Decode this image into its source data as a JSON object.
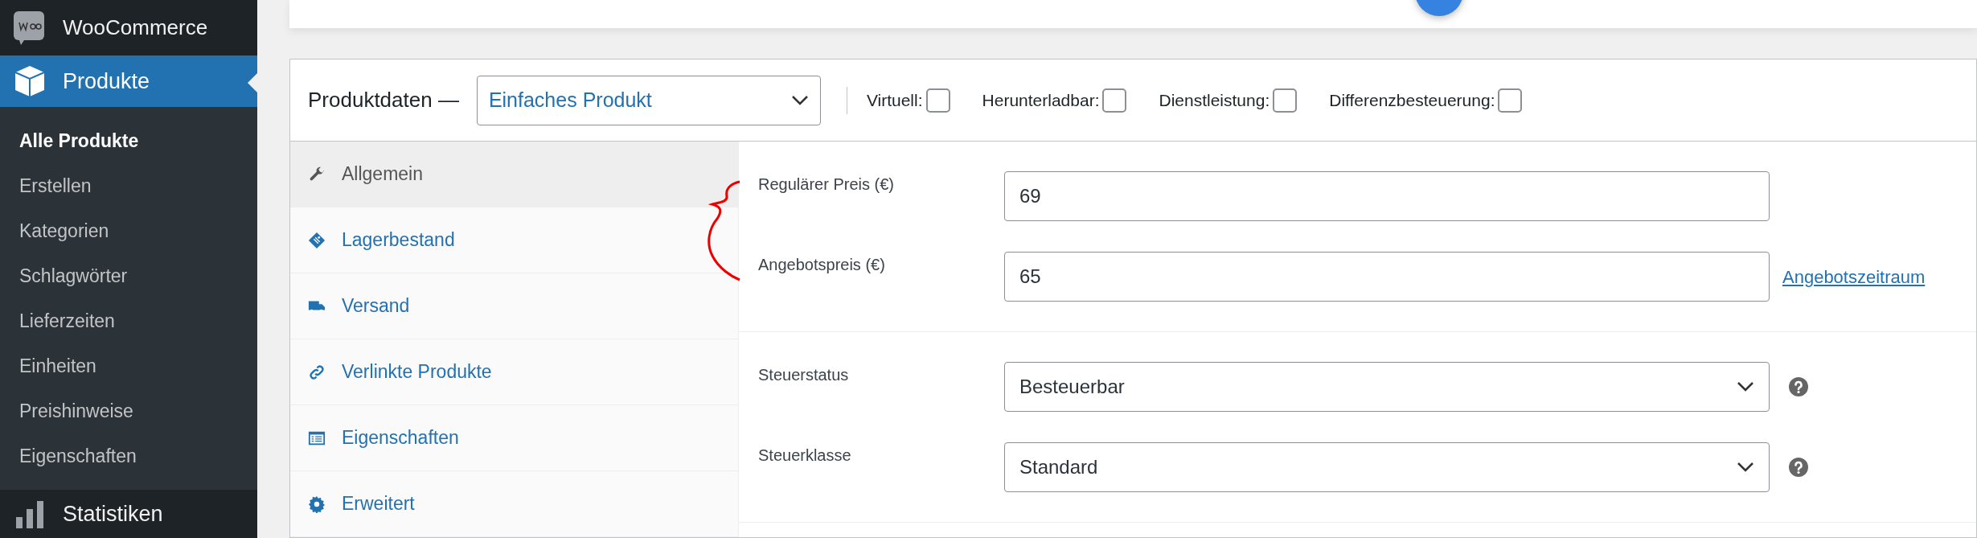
{
  "sidebar": {
    "header": {
      "label": "WooCommerce",
      "selected": false
    },
    "active_menu": {
      "label": "Produkte",
      "selected": true
    },
    "submenu": [
      {
        "label": "Alle Produkte",
        "selected": true
      },
      {
        "label": "Erstellen",
        "selected": false
      },
      {
        "label": "Kategorien",
        "selected": false
      },
      {
        "label": "Schlagwörter",
        "selected": false
      },
      {
        "label": "Lieferzeiten",
        "selected": false
      },
      {
        "label": "Einheiten",
        "selected": false
      },
      {
        "label": "Preishinweise",
        "selected": false
      },
      {
        "label": "Eigenschaften",
        "selected": false
      }
    ],
    "next_menu": {
      "label": "Statistiken",
      "selected": false
    }
  },
  "product_data": {
    "title": "Produktdaten —",
    "product_type": "Einfaches Produkt",
    "options": [
      {
        "label": "Virtuell:",
        "checked": false
      },
      {
        "label": "Herunterladbar:",
        "checked": false
      },
      {
        "label": "Dienstleistung:",
        "checked": false
      },
      {
        "label": "Differenzbesteuerung:",
        "checked": false
      }
    ],
    "tabs": [
      {
        "kind": "wrench",
        "label": "Allgemein",
        "selected": true
      },
      {
        "kind": "tag",
        "label": "Lagerbestand",
        "selected": false
      },
      {
        "kind": "truck",
        "label": "Versand",
        "selected": false
      },
      {
        "kind": "link",
        "label": "Verlinkte Produkte",
        "selected": false
      },
      {
        "kind": "list",
        "label": "Eigenschaften",
        "selected": false
      },
      {
        "kind": "gear",
        "label": "Erweitert",
        "selected": false
      }
    ],
    "field_groups": [
      [
        {
          "kind": "text",
          "label": "Regulärer Preis (€)",
          "value": "69"
        },
        {
          "kind": "text",
          "label": "Angebotspreis (€)",
          "value": "65",
          "link": "Angebotszeitraum"
        }
      ],
      [
        {
          "kind": "select",
          "label": "Steuerstatus",
          "value": "Besteuerbar",
          "help": true
        },
        {
          "kind": "select",
          "label": "Steuerklasse",
          "value": "Standard",
          "help": true
        }
      ]
    ]
  }
}
